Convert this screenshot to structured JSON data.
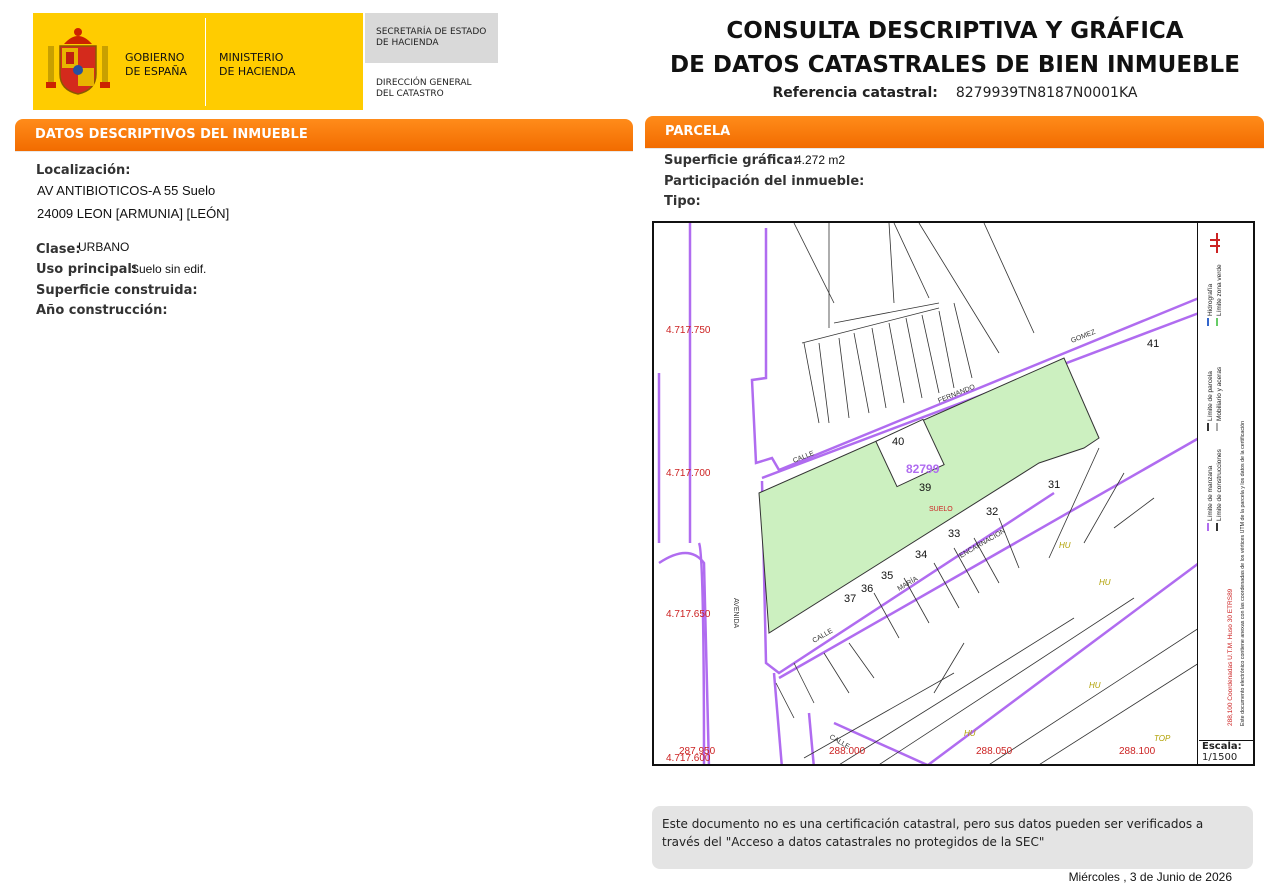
{
  "header": {
    "gobierno": [
      "GOBIERNO",
      "DE ESPAÑA"
    ],
    "ministerio": [
      "MINISTERIO",
      "DE HACIENDA"
    ],
    "secretaria": [
      "SECRETARÍA DE ESTADO",
      "DE HACIENDA"
    ],
    "direccion": [
      "DIRECCIÓN GENERAL",
      "DEL CATASTRO"
    ],
    "title_line1": "CONSULTA DESCRIPTIVA Y GRÁFICA",
    "title_line2": "DE DATOS CATASTRALES DE BIEN INMUEBLE",
    "ref_label": "Referencia catastral:",
    "ref_value": "8279939TN8187N0001KA"
  },
  "descriptivos": {
    "header": "DATOS DESCRIPTIVOS DEL INMUEBLE",
    "localizacion_label": "Localización:",
    "localizacion_line1": "AV ANTIBIOTICOS-A 55 Suelo",
    "localizacion_line2": "24009 LEON [ARMUNIA] [LEÓN]",
    "clase_label": "Clase:",
    "clase_value": "URBANO",
    "uso_label": "Uso principal:",
    "uso_value": "Suelo sin edif.",
    "superficie_label": "Superficie construida:",
    "ano_label": "Año construcción:"
  },
  "parcela": {
    "header": "PARCELA",
    "superficie_label": "Superficie gráfica:",
    "superficie_value": "4.272 m2",
    "participacion_label": "Participación del inmueble:",
    "tipo_label": "Tipo:"
  },
  "map": {
    "parcel_highlight_color": "#ccf0c0",
    "boundary_color": "#b06cf0",
    "utm_y_labels": [
      "4.717.750",
      "4.717.700",
      "4.717.650",
      "4.717.600"
    ],
    "utm_x_labels": [
      "287.950",
      "288.000",
      "288.050",
      "288.100"
    ],
    "parcel_id": "82799",
    "parcel_type": "SUELO",
    "block_numbers": [
      "41",
      "40",
      "39",
      "31",
      "32",
      "33",
      "34",
      "35",
      "36",
      "37"
    ],
    "street_labels": [
      "CALLE",
      "FERNANDO",
      "GOMEZ",
      "AVENIDA",
      "CALLE",
      "MARÍA",
      "CALLE",
      "ENCARNACION"
    ],
    "zone_labels": [
      "HU",
      "HU",
      "HU",
      "HU",
      "TOP"
    ]
  },
  "legend": {
    "items": [
      "Límite de manzana",
      "Límite de parcela",
      "Hidrografía",
      "Límite de construcciones",
      "Mobiliario y aceras",
      "Límite zona verde"
    ],
    "coords_note": "288,100 Coordenadas U.T.M. Huso 30 ETRS89",
    "doc_note": "Este documento electrónico contiene anexas con las coordenadas de los vértices UTM de la parcela y los datos de la certificación",
    "escala_label": "Escala:",
    "escala_value": "1/1500"
  },
  "note": "Este documento no es una certificación catastral, pero sus datos pueden ser verificados a través del \"Acceso a datos catastrales no protegidos de la SEC\"",
  "date": "Miércoles , 3 de Junio de 2026",
  "colors": {
    "accent": "#f26c00",
    "logo_yellow": "#ffcc00"
  }
}
